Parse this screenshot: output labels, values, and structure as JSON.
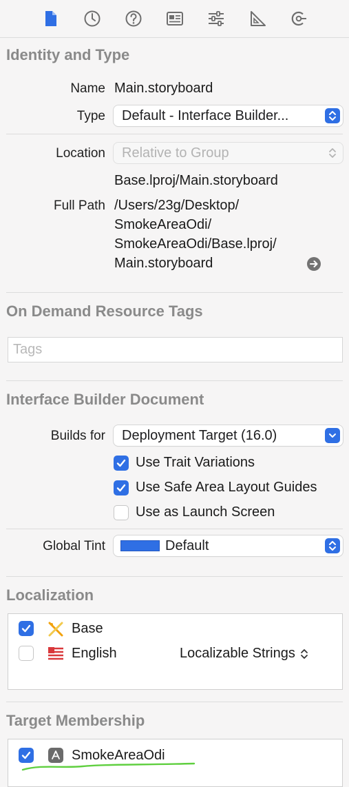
{
  "tabs": [
    {
      "icon": "file-icon",
      "active": true
    },
    {
      "icon": "clock-icon",
      "active": false
    },
    {
      "icon": "help-icon",
      "active": false
    },
    {
      "icon": "identity-card-icon",
      "active": false
    },
    {
      "icon": "sliders-icon",
      "active": false
    },
    {
      "icon": "ruler-icon",
      "active": false
    },
    {
      "icon": "connections-icon",
      "active": false
    }
  ],
  "identity": {
    "title": "Identity and Type",
    "name_label": "Name",
    "name_value": "Main.storyboard",
    "type_label": "Type",
    "type_value": "Default - Interface Builder...",
    "location_label": "Location",
    "location_value": "Relative to Group",
    "relative_path": "Base.lproj/Main.storyboard",
    "fullpath_label": "Full Path",
    "fullpath_lines": [
      "/Users/23g/Desktop/",
      "SmokeAreaOdi/",
      "SmokeAreaOdi/Base.lproj/",
      "Main.storyboard"
    ]
  },
  "odr": {
    "title": "On Demand Resource Tags",
    "tags_placeholder": "Tags"
  },
  "ibdoc": {
    "title": "Interface Builder Document",
    "builds_for_label": "Builds for",
    "builds_for_value": "Deployment Target (16.0)",
    "options": [
      {
        "label": "Use Trait Variations",
        "checked": true
      },
      {
        "label": "Use Safe Area Layout Guides",
        "checked": true
      },
      {
        "label": "Use as Launch Screen",
        "checked": false
      }
    ],
    "global_tint_label": "Global Tint",
    "global_tint_value": "Default",
    "tint_color": "#2f6fe4"
  },
  "localization": {
    "title": "Localization",
    "items": [
      {
        "label": "Base",
        "checked": true,
        "icon": "base-localization-icon"
      },
      {
        "label": "English",
        "checked": false,
        "icon": "english-flag-icon",
        "format": "Localizable Strings"
      }
    ]
  },
  "target_membership": {
    "title": "Target Membership",
    "items": [
      {
        "label": "SmokeAreaOdi",
        "checked": true,
        "icon": "app-target-icon"
      }
    ]
  },
  "colors": {
    "accent": "#2f6fe4",
    "section_title": "#8a8a8a",
    "annotation_underline": "#5fcf3f"
  }
}
